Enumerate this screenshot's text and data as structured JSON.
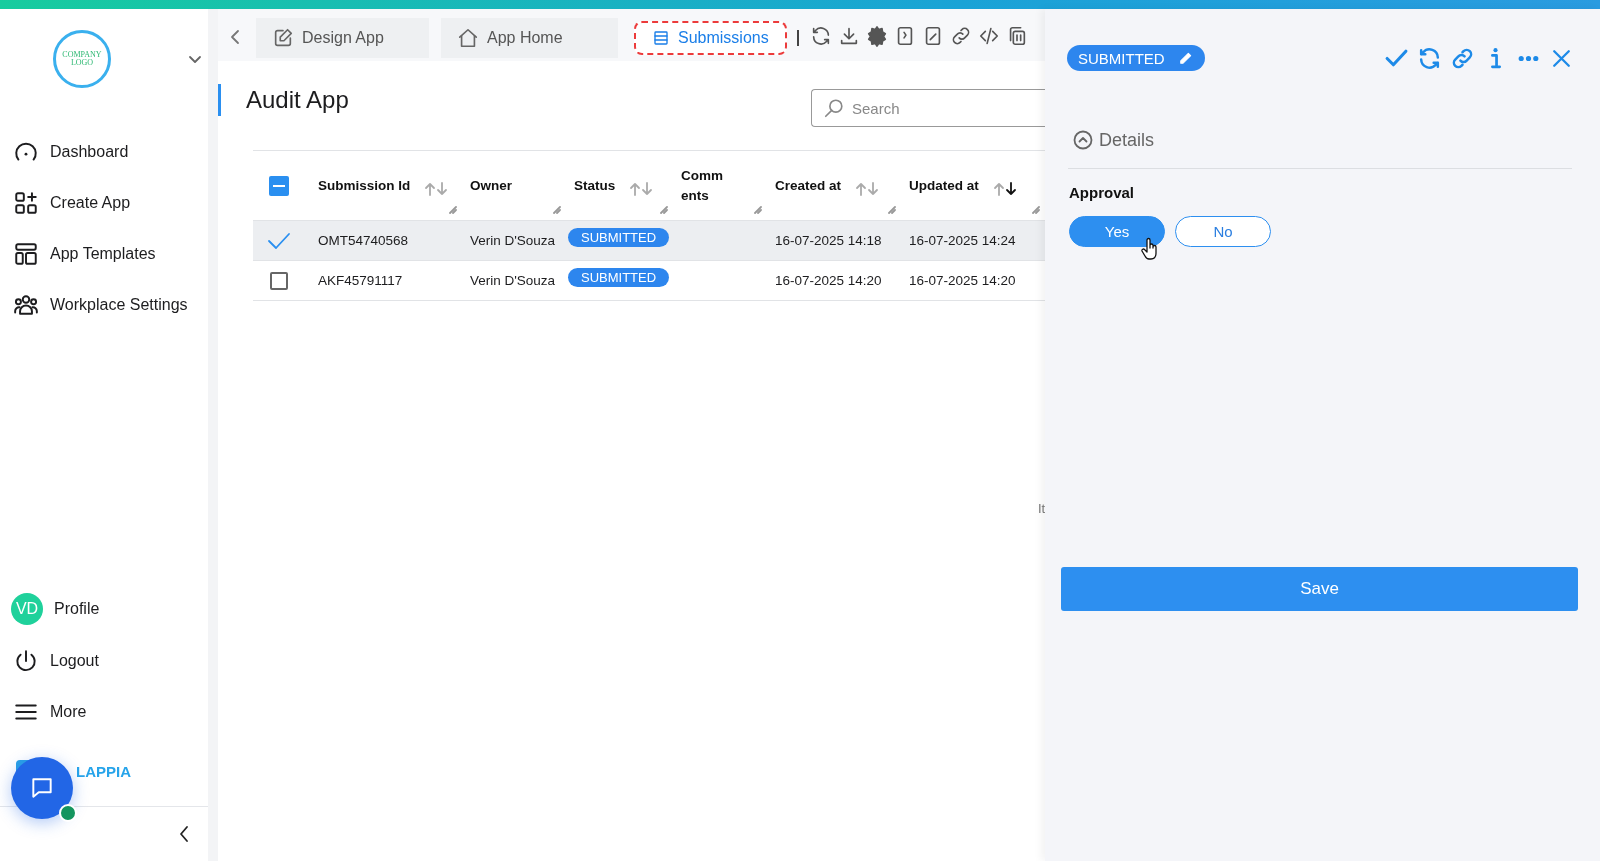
{
  "sidebar": {
    "logo_text": "COMPANY LOGO",
    "nav": [
      {
        "label": "Dashboard",
        "kind": "gauge"
      },
      {
        "label": "Create App",
        "kind": "create"
      },
      {
        "label": "App Templates",
        "kind": "templates"
      },
      {
        "label": "Workplace Settings",
        "kind": "people"
      }
    ],
    "profile": {
      "initials": "VD",
      "label": "Profile",
      "color": "#1fd19b"
    },
    "bottom": [
      {
        "label": "Logout",
        "kind": "power"
      },
      {
        "label": "More",
        "kind": "menu"
      }
    ],
    "brand": "LAPPIA"
  },
  "tabs": [
    {
      "label": "Design App",
      "kind": "edit",
      "selected": false
    },
    {
      "label": "App Home",
      "kind": "home",
      "selected": false
    },
    {
      "label": "Submissions",
      "kind": "list",
      "selected": true
    }
  ],
  "page_title": "Audit App",
  "search": {
    "placeholder": "Search"
  },
  "table": {
    "select_all": {
      "indeterminate": true
    },
    "columns": [
      {
        "label": "Submission Id",
        "sortable": true,
        "sorted_desc": false
      },
      {
        "label": "Owner",
        "sortable": false
      },
      {
        "label": "Status",
        "sortable": true,
        "sorted_desc": false
      },
      {
        "label": "Comments",
        "sortable": false
      },
      {
        "label": "Created at",
        "sortable": true,
        "sorted_desc": false
      },
      {
        "label": "Updated at",
        "sortable": true,
        "sorted_desc": true
      }
    ],
    "rows": [
      {
        "selected": true,
        "submission_id": "OMT54740568",
        "owner": "Verin D'Souza",
        "status": "SUBMITTED",
        "created_at": "16-07-2025 14:18",
        "updated_at": "16-07-2025 14:24"
      },
      {
        "selected": false,
        "submission_id": "AKF45791117",
        "owner": "Verin D'Souza",
        "status": "SUBMITTED",
        "created_at": "16-07-2025 14:20",
        "updated_at": "16-07-2025 14:20"
      }
    ]
  },
  "edge_text": "It",
  "panel": {
    "status": "SUBMITTED",
    "section": {
      "title": "Details",
      "expanded": true
    },
    "field": {
      "label": "Approval",
      "options": [
        {
          "label": "Yes",
          "selected": true
        },
        {
          "label": "No",
          "selected": false
        }
      ]
    },
    "save": "Save"
  }
}
